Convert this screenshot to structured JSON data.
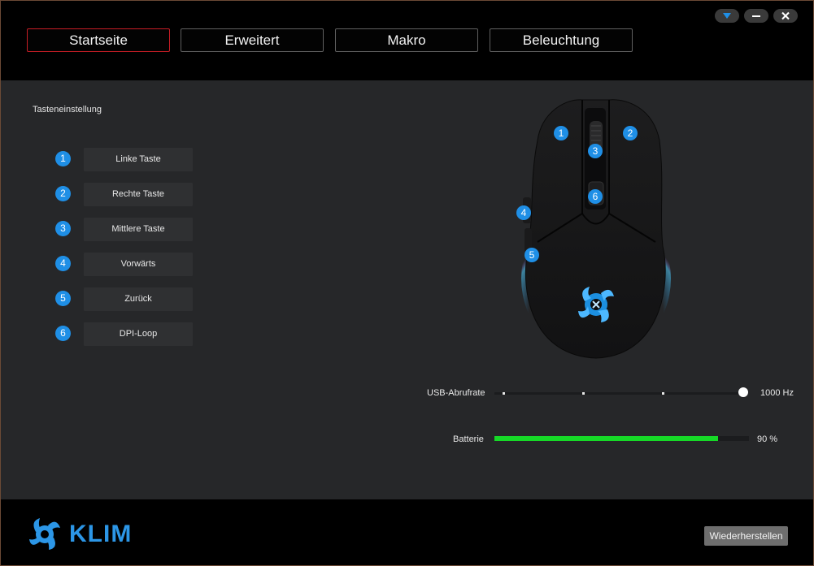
{
  "header": {
    "tabs": [
      {
        "label": "Startseite",
        "active": true
      },
      {
        "label": "Erweitert",
        "active": false
      },
      {
        "label": "Makro",
        "active": false
      },
      {
        "label": "Beleuchtung",
        "active": false
      }
    ],
    "window_controls": [
      "dropdown-icon",
      "minimize-icon",
      "close-icon"
    ]
  },
  "main": {
    "section_title": "Tasteneinstellung",
    "buttons": [
      {
        "num": "1",
        "label": "Linke Taste"
      },
      {
        "num": "2",
        "label": "Rechte Taste"
      },
      {
        "num": "3",
        "label": "Mittlere Taste"
      },
      {
        "num": "4",
        "label": "Vorwärts"
      },
      {
        "num": "5",
        "label": "Zurück"
      },
      {
        "num": "6",
        "label": "DPI-Loop"
      }
    ],
    "mouse_markers": [
      "1",
      "2",
      "3",
      "4",
      "5",
      "6"
    ],
    "usb_rate": {
      "label": "USB-Abrufrate",
      "value": "1000 Hz",
      "steps": 4,
      "selected_step": 4
    },
    "battery": {
      "label": "Batterie",
      "value": "90 %",
      "level": 0.88
    }
  },
  "footer": {
    "logo_text": "KLIM",
    "restore_label": "Wiederherstellen"
  },
  "colors": {
    "accent_blue": "#1f8fe6",
    "active_tab_border": "#c81d25",
    "battery_green": "#16d927"
  }
}
